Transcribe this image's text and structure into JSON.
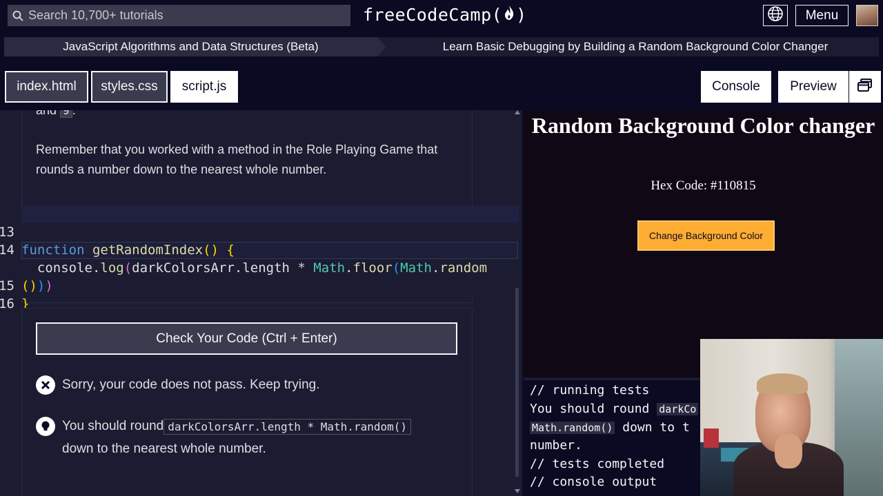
{
  "topnav": {
    "search_placeholder": "Search 10,700+ tutorials",
    "brand_left": "freeCodeCamp(",
    "brand_right": ")",
    "menu_label": "Menu"
  },
  "breadcrumb": {
    "course": "JavaScript Algorithms and Data Structures (Beta)",
    "lesson": "Learn Basic Debugging by Building a Random Background Color Changer"
  },
  "tabs": {
    "index": "index.html",
    "styles": "styles.css",
    "script": "script.js",
    "console": "Console",
    "preview": "Preview"
  },
  "description": {
    "top_prefix": "and ",
    "top_code": "9",
    "top_suffix": ".",
    "text": "Remember that you worked with a method in the Role Playing Game that rounds a number down to the nearest whole number."
  },
  "editor": {
    "lines": [
      {
        "num": "13"
      },
      {
        "num": "14"
      },
      {
        "num": ""
      },
      {
        "num": "15"
      },
      {
        "num": "16"
      }
    ]
  },
  "check": {
    "button": "Check Your Code (Ctrl + Enter)",
    "fail_msg": "Sorry, your code does not pass. Keep trying.",
    "hint_prefix": "You should round ",
    "hint_code": "darkColorsArr.length * Math.random()",
    "hint_suffix": "down to the nearest whole number."
  },
  "preview": {
    "title": "Random Background Color changer",
    "hex": "Hex Code: #110815",
    "button": "Change Background Color",
    "bg_color": "#110815",
    "button_color": "#feac32"
  },
  "console": {
    "line1": "// running tests",
    "line2_prefix": "You should round ",
    "line2_code": "darkCo",
    "line3_code": "Math.random()",
    "line3_suffix": " down to t",
    "line4": "number.",
    "line5": "// tests completed",
    "line6": "// console output"
  },
  "icons": {
    "search": "search-icon",
    "globe": "globe-icon",
    "flame": "flame-icon",
    "popout": "popout-icon",
    "fail": "close-circle-icon",
    "hint": "lightbulb-icon"
  }
}
